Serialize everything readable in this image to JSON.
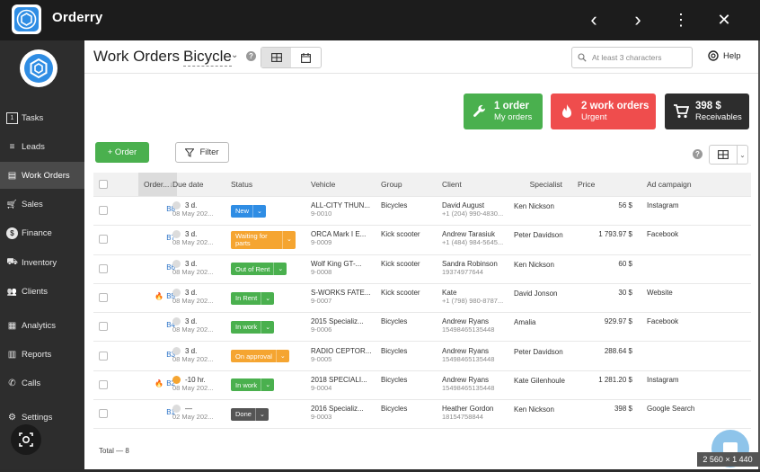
{
  "app": {
    "title": "Orderry"
  },
  "topbar": {
    "back": "‹",
    "forward": "›",
    "more": "⋮",
    "close": "✕"
  },
  "sidebar": {
    "items": [
      {
        "label": "Tasks",
        "icon": "tasks-icon",
        "badge": "1"
      },
      {
        "label": "Leads",
        "icon": "leads-icon"
      },
      {
        "label": "Work Orders",
        "icon": "work-orders-icon",
        "active": true
      },
      {
        "label": "Sales",
        "icon": "cart-icon"
      },
      {
        "label": "Finance",
        "icon": "dollar-icon"
      },
      {
        "label": "Inventory",
        "icon": "truck-icon"
      },
      {
        "label": "Clients",
        "icon": "users-icon"
      },
      {
        "label": "Analytics",
        "icon": "chart-icon"
      },
      {
        "label": "Reports",
        "icon": "reports-icon"
      },
      {
        "label": "Calls",
        "icon": "phone-icon"
      },
      {
        "label": "Settings",
        "icon": "gear-icon"
      }
    ]
  },
  "header": {
    "title": "Work Orders",
    "department": "Bicycle",
    "search_placeholder": "At least 3 characters",
    "help": "Help"
  },
  "cards": [
    {
      "title": "1 order",
      "subtitle": "My orders",
      "color": "#4ab04e",
      "icon": "wrench-icon"
    },
    {
      "title": "2 work orders",
      "subtitle": "Urgent",
      "color": "#ef4d4d",
      "icon": "fire-icon"
    },
    {
      "title": "398 $",
      "subtitle": "Receivables",
      "color": "#2d2d2d",
      "icon": "cart-icon"
    }
  ],
  "toolbar": {
    "order_label": "+ Order",
    "filter_label": "Filter"
  },
  "table": {
    "columns": [
      "Order...",
      "Due date",
      "Status",
      "Vehicle",
      "Group",
      "Client",
      "Specialist",
      "Price",
      "Ad campaign"
    ],
    "rows": [
      {
        "num": "B8",
        "urgent": false,
        "overdue": false,
        "due": "3 d.",
        "date": "08 May 202...",
        "status": "New",
        "status_color": "#2f8de4",
        "vehicle": "ALL-CITY THUN...",
        "vin": "9-0010",
        "group": "Bicycles",
        "client": "David August",
        "phone": "+1 (204) 990-4830...",
        "specialist": "Ken Nickson",
        "price": "56 $",
        "ad": "Instagram"
      },
      {
        "num": "B7",
        "urgent": false,
        "overdue": false,
        "due": "3 d.",
        "date": "08 May 202...",
        "status": "Waiting for parts",
        "status_color": "#f5a531",
        "vehicle": "ORCA Mark I E...",
        "vin": "9-0009",
        "group": "Kick scooter",
        "client": "Andrew Tarasiuk",
        "phone": "+1 (484) 984-5645...",
        "specialist": "Peter Davidson",
        "price": "1 793.97 $",
        "ad": "Facebook"
      },
      {
        "num": "B6",
        "urgent": false,
        "overdue": false,
        "due": "3 d.",
        "date": "08 May 202...",
        "status": "Out of Rent",
        "status_color": "#4ab04e",
        "vehicle": "Wolf King GT-...",
        "vin": "9-0008",
        "group": "Kick scooter",
        "client": "Sandra Robinson",
        "phone": "19374977644",
        "specialist": "Ken Nickson",
        "price": "60 $",
        "ad": ""
      },
      {
        "num": "B5",
        "urgent": true,
        "overdue": false,
        "due": "3 d.",
        "date": "08 May 202...",
        "status": "In Rent",
        "status_color": "#4ab04e",
        "vehicle": "S-WORKS FATE...",
        "vin": "9-0007",
        "group": "Kick scooter",
        "client": "Kate",
        "phone": "+1 (798) 980-8787...",
        "specialist": "David Jonson",
        "price": "30 $",
        "ad": "Website"
      },
      {
        "num": "B4",
        "urgent": false,
        "overdue": false,
        "due": "3 d.",
        "date": "08 May 202...",
        "status": "In work",
        "status_color": "#4ab04e",
        "vehicle": "2015 Specializ...",
        "vin": "9-0006",
        "group": "Bicycles",
        "client": "Andrew Ryans",
        "phone": "15498465135448",
        "specialist": "Amalia",
        "price": "929.97 $",
        "ad": "Facebook"
      },
      {
        "num": "B3",
        "urgent": false,
        "overdue": false,
        "due": "3 d.",
        "date": "08 May 202...",
        "status": "On approval",
        "status_color": "#f5a531",
        "vehicle": "RADIO CEPTOR...",
        "vin": "9-0005",
        "group": "Bicycles",
        "client": "Andrew Ryans",
        "phone": "15498465135448",
        "specialist": "Peter Davidson",
        "price": "288.64 $",
        "ad": ""
      },
      {
        "num": "B2",
        "urgent": true,
        "overdue": true,
        "due": "-10 hr.",
        "date": "08 May 202...",
        "status": "In work",
        "status_color": "#4ab04e",
        "vehicle": "2018 SPECIALI...",
        "vin": "9-0004",
        "group": "Bicycles",
        "client": "Andrew Ryans",
        "phone": "15498465135448",
        "specialist": "Kate Gilenhoule",
        "price": "1 281.20 $",
        "ad": "Instagram"
      },
      {
        "num": "B1",
        "urgent": false,
        "overdue": false,
        "due": "—",
        "date": "02 May 202...",
        "status": "Done",
        "status_color": "#555555",
        "vehicle": "2016 Specializ...",
        "vin": "9-0003",
        "group": "Bicycles",
        "client": "Heather Gordon",
        "phone": "18154758844",
        "specialist": "Ken Nickson",
        "price": "398 $",
        "ad": "Google Search"
      }
    ],
    "total": "Total — 8"
  },
  "badge": {
    "resolution": "2 560 × 1 440"
  }
}
